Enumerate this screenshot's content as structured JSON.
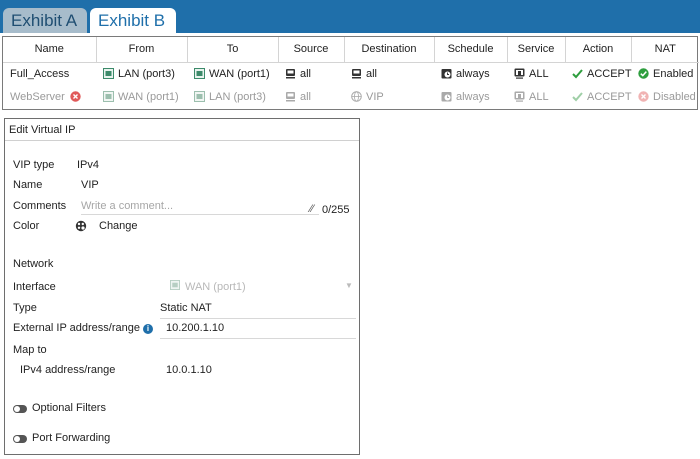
{
  "tabs": [
    {
      "label": "Exhibit A",
      "active": false
    },
    {
      "label": "Exhibit B",
      "active": true
    }
  ],
  "policy_table": {
    "headers": [
      "Name",
      "From",
      "To",
      "Source",
      "Destination",
      "Schedule",
      "Service",
      "Action",
      "NAT"
    ],
    "rows": [
      {
        "name": "Full_Access",
        "from": "LAN (port3)",
        "to": "WAN (port1)",
        "source": "all",
        "destination": "all",
        "schedule": "always",
        "service": "ALL",
        "action": "ACCEPT",
        "nat": "Enabled",
        "disabled": false
      },
      {
        "name": "WebServer",
        "from": "WAN (port1)",
        "to": "LAN (port3)",
        "source": "all",
        "destination": "VIP",
        "schedule": "always",
        "service": "ALL",
        "action": "ACCEPT",
        "nat": "Disabled",
        "disabled": true
      }
    ]
  },
  "vip_form": {
    "title": "Edit Virtual IP",
    "vip_type_label": "VIP type",
    "vip_type_value": "IPv4",
    "name_label": "Name",
    "name_value": "VIP",
    "comments_label": "Comments",
    "comments_placeholder": "Write a comment...",
    "comments_counter": "0/255",
    "color_label": "Color",
    "color_change": "Change",
    "network_heading": "Network",
    "interface_label": "Interface",
    "interface_value": "WAN (port1)",
    "type_label": "Type",
    "type_value": "Static NAT",
    "external_ip_label": "External IP address/range",
    "external_ip_value": "10.200.1.10",
    "map_to_label": "Map to",
    "ipv4_range_label": "IPv4 address/range",
    "ipv4_range_value": "10.0.1.10",
    "optional_filters_label": "Optional Filters",
    "port_forwarding_label": "Port Forwarding"
  },
  "colors": {
    "tab_bar": "#1f6faa",
    "accept_green": "#2e9e3e",
    "error_red": "#e05a5a"
  }
}
